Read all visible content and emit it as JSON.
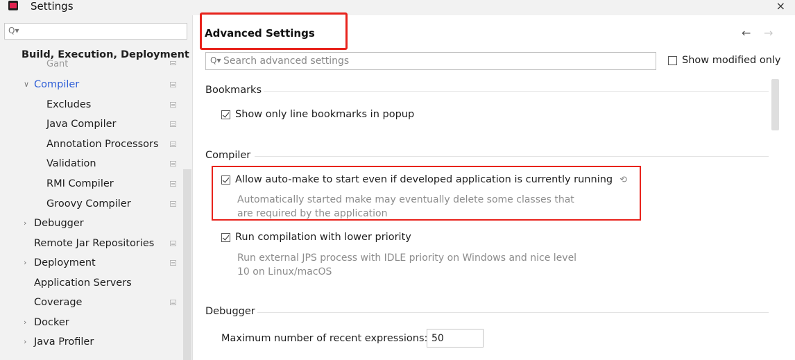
{
  "window": {
    "title": "Settings",
    "close_glyph": "×"
  },
  "sidebar": {
    "search": {
      "value": "",
      "placeholder": "",
      "icon": "search-icon"
    },
    "items": [
      {
        "label": "Build, Execution, Deployment",
        "bold": true
      },
      {
        "label": "Gant"
      },
      {
        "label": "Compiler",
        "expanded": true,
        "selected": true
      },
      {
        "label": "Excludes"
      },
      {
        "label": "Java Compiler"
      },
      {
        "label": "Annotation Processors"
      },
      {
        "label": "Validation"
      },
      {
        "label": "RMI Compiler"
      },
      {
        "label": "Groovy Compiler"
      },
      {
        "label": "Debugger",
        "collapsed": true
      },
      {
        "label": "Remote Jar Repositories"
      },
      {
        "label": "Deployment",
        "collapsed": true
      },
      {
        "label": "Application Servers"
      },
      {
        "label": "Coverage"
      },
      {
        "label": "Docker",
        "collapsed": true
      },
      {
        "label": "Java Profiler",
        "collapsed": true
      }
    ]
  },
  "main": {
    "title": "Advanced Settings",
    "nav": {
      "back": "←",
      "forward": "→"
    },
    "search": {
      "placeholder": "Search advanced settings",
      "value": ""
    },
    "show_modified_only": {
      "label": "Show modified only",
      "checked": false
    },
    "sections": {
      "bookmarks": {
        "title": "Bookmarks",
        "options": [
          {
            "label": "Show only line bookmarks in popup",
            "checked": true
          }
        ]
      },
      "compiler": {
        "title": "Compiler",
        "options": [
          {
            "label": "Allow auto-make to start even if developed application is currently running",
            "checked": true,
            "modified": true,
            "desc_line1": "Automatically started make may eventually delete some classes that",
            "desc_line2": "are required by the application"
          },
          {
            "label": "Run compilation with lower priority",
            "checked": true,
            "desc_line1": "Run external JPS process with IDLE priority on Windows and nice level",
            "desc_line2": "10 on Linux/macOS"
          }
        ]
      },
      "debugger": {
        "title": "Debugger",
        "max_recent_expressions": {
          "label": "Maximum number of recent expressions:",
          "value": "50"
        }
      }
    }
  },
  "colors": {
    "highlight_red": "#e8231c",
    "selected_blue": "#2f5fd7",
    "sidebar_bg": "#f2f2f2",
    "muted_text": "#8c8c8c"
  }
}
